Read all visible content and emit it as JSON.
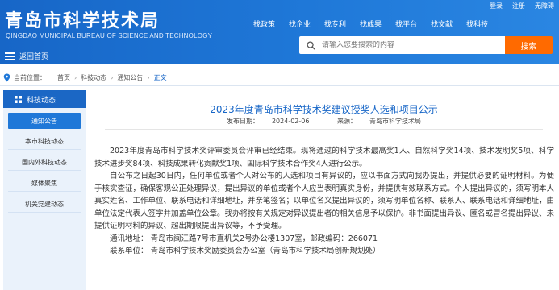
{
  "header": {
    "title": "青岛市科学技术局",
    "subtitle": "QINGDAO MUNICIPAL BUREAU OF SCIENCE AND TECHNOLOGY",
    "back_home": "返回首页",
    "top_links": [
      "登录",
      "注册",
      "无障碍"
    ],
    "nav": [
      "找政策",
      "找企业",
      "找专利",
      "找成果",
      "找平台",
      "找文献",
      "找科技"
    ],
    "search_placeholder": "请输入您要搜索的内容",
    "search_button": "搜索",
    "colors": {
      "header_blue": "#1766c7",
      "search_orange": "#ff6a00"
    }
  },
  "breadcrumb": {
    "label": "当前位置：",
    "items": [
      "首页",
      "科技动态",
      "通知公告",
      "正文"
    ]
  },
  "sidebar": {
    "title": "科技动态",
    "items": [
      "通知公告",
      "本市科技动态",
      "国内外科技动态",
      "媒体聚焦",
      "机关党建动态"
    ],
    "active_index": 0
  },
  "article": {
    "title": "2023年度青岛市科学技术奖建议授奖人选和项目公示",
    "date_label": "发布日期：",
    "date": "2024-02-06",
    "source_label": "来源：",
    "source": "青岛市科学技术局",
    "p1": "2023年度青岛市科学技术奖评审委员会评审已经结束。现将通过的科学技术最高奖1人、自然科学奖14项、技术发明奖5项、科学技术进步奖84项、科技成果转化贡献奖1项、国际科学技术合作奖4人进行公示。",
    "p2": "自公布之日起30日内，任何单位或者个人对公布的人选和项目有异议的，应以书面方式向我办提出，并提供必要的证明材料。为便于核实查证，确保客观公正处理异议，提出异议的单位或者个人应当表明真实身份，并提供有效联系方式。个人提出异议的，须写明本人真实姓名、工作单位、联系电话和详细地址，并亲笔签名；以单位名义提出异议的，须写明单位名称、联系人、联系电话和详细地址，由单位法定代表人签字并加盖单位公章。我办将按有关规定对异议提出者的相关信息予以保护。非书面提出异议、匿名或冒名提出异议、未提供证明材料的异议、超出期限提出异议等，不予受理。",
    "address": "通讯地址：  青岛市闽江路7号市直机关2号办公楼1307室，邮政编码：266071",
    "contact": "联系单位：  青岛市科学技术奖励委员会办公室（青岛市科学技术局创新规划处）"
  }
}
